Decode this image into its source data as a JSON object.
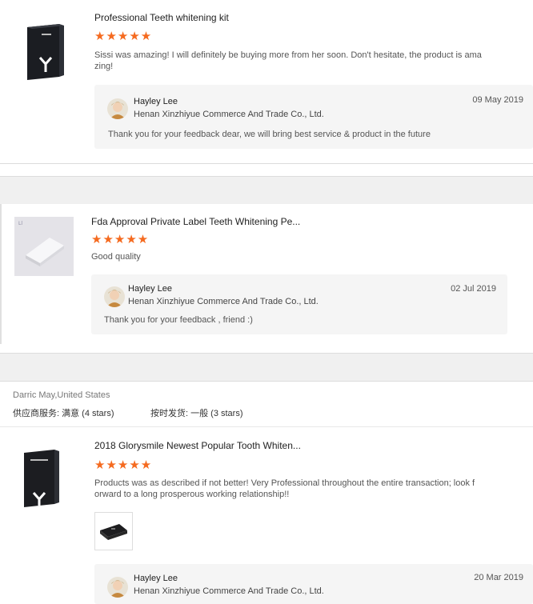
{
  "reviews": [
    {
      "product_title": "Professional Teeth whitening kit",
      "stars": "★★★★★",
      "rating_value": 5,
      "comment_line1": "Sissi was amazing! I will definitely be buying more from her soon. Don't hesitate, the product is ama",
      "comment_line2": "zing!",
      "reply": {
        "name": "Hayley Lee",
        "company": "Henan Xinzhiyue Commerce And Trade Co., Ltd.",
        "date": "09 May 2019",
        "text": "Thank you for your feedback dear, we will bring best service & product in the future"
      }
    },
    {
      "product_title": "Fda Approval Private Label Teeth Whitening Pe...",
      "stars": "★★★★★",
      "rating_value": 5,
      "comment": "Good quality",
      "reply": {
        "name": "Hayley Lee",
        "company": "Henan Xinzhiyue Commerce And Trade Co., Ltd.",
        "date": "02 Jul 2019",
        "text": "Thank you for your feedback , friend :)"
      }
    },
    {
      "buyer": "Darric May,United States",
      "supplier_service": "供应商服务: 满意  (4 stars)",
      "on_time_shipping": "按时发货: 一般  (3 stars)",
      "product_title": "2018 Glorysmile Newest Popular Tooth Whiten...",
      "stars": "★★★★★",
      "rating_value": 5,
      "comment_line1": "Products was as described if not better!  Very Professional throughout the entire transaction; look f",
      "comment_line2": "orward to a long prosperous working relationship!!",
      "reply": {
        "name": "Hayley Lee",
        "company": "Henan Xinzhiyue Commerce And Trade Co., Ltd.",
        "date": "20 Mar 2019"
      }
    }
  ],
  "colors": {
    "star": "#f56a1f",
    "reply_bg": "#f5f5f5",
    "band_bg": "#f0f0f0"
  },
  "icons": {
    "product_box": "black-box-icon",
    "avatar": "user-avatar-icon"
  }
}
